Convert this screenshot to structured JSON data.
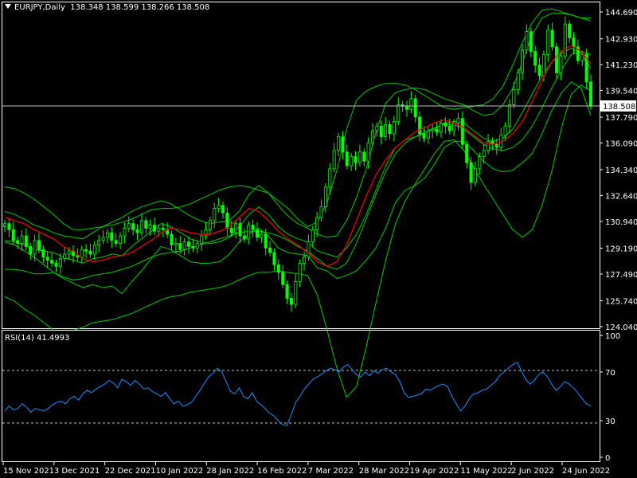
{
  "header": {
    "symbol": "EURJPY,Daily",
    "ohlc": "138.348 138.599 138.266 138.508"
  },
  "rsi_header": {
    "label": "RSI(14)",
    "value": "41.4993"
  },
  "colors": {
    "background": "#000000",
    "frame": "#ffffff",
    "candle": "#00ff00",
    "ma": "#ff0000",
    "bands": "#00cc00",
    "rsi": "#1e90ff",
    "level": "#c0c0c0"
  },
  "chart_data": [
    {
      "type": "candlestick",
      "title": "EURJPY,Daily",
      "x_ticks": [
        "15 Nov 2021",
        "3 Dec 2021",
        "22 Dec 2021",
        "10 Jan 2022",
        "28 Jan 2022",
        "16 Feb 2022",
        "7 Mar 2022",
        "28 Mar 2022",
        "19 Apr 2022",
        "11 May 2022",
        "2 Jun 2022",
        "24 Jun 2022"
      ],
      "y_ticks": [
        "144.690",
        "142.930",
        "141.230",
        "139.540",
        "137.790",
        "136.090",
        "134.340",
        "132.640",
        "130.940",
        "129.190",
        "127.490",
        "125.740",
        "124.040"
      ],
      "ylim": [
        124.04,
        144.69
      ],
      "current_price": "138.508",
      "close": [
        130.8,
        130.4,
        129.7,
        129.5,
        130.0,
        129.3,
        128.8,
        129.7,
        129.1,
        128.6,
        128.4,
        128.2,
        128.0,
        128.5,
        128.8,
        129.0,
        128.7,
        128.6,
        129.1,
        129.0,
        128.8,
        129.4,
        129.7,
        129.9,
        130.2,
        129.7,
        129.5,
        130.0,
        130.5,
        130.8,
        130.4,
        130.2,
        131.0,
        130.5,
        130.7,
        130.3,
        130.5,
        130.4,
        130.1,
        129.4,
        129.5,
        129.1,
        129.6,
        129.3,
        129.2,
        129.5,
        130.0,
        130.4,
        131.0,
        131.8,
        132.0,
        131.5,
        130.5,
        130.2,
        130.8,
        130.0,
        129.8,
        130.7,
        130.4,
        129.9,
        130.1,
        129.2,
        128.9,
        128.1,
        127.6,
        126.8,
        125.9,
        125.5,
        127.0,
        128.2,
        128.6,
        129.6,
        130.4,
        131.2,
        131.9,
        133.2,
        134.4,
        135.6,
        136.5,
        135.5,
        134.6,
        135.2,
        134.8,
        135.5,
        134.9,
        136.1,
        136.9,
        137.2,
        136.5,
        137.3,
        136.7,
        137.5,
        138.6,
        138.5,
        138.3,
        139.0,
        137.8,
        136.7,
        136.4,
        136.9,
        137.0,
        136.8,
        137.4,
        137.2,
        136.9,
        137.4,
        137.7,
        136.0,
        134.8,
        133.5,
        134.4,
        135.2,
        135.6,
        136.2,
        136.0,
        135.8,
        136.6,
        137.2,
        138.6,
        139.6,
        140.7,
        142.2,
        143.4,
        142.1,
        141.2,
        140.5,
        141.9,
        143.5,
        142.4,
        140.7,
        141.8,
        143.9,
        143.0,
        142.4,
        141.5,
        141.9,
        140.1,
        138.5
      ],
      "series": [
        {
          "name": "",
          "values": [
            129.7,
            129.6,
            129.4,
            129.1,
            129.0,
            128.9,
            128.6,
            128.4,
            128.2,
            128.5,
            128.6,
            128.8,
            128.7,
            129.3,
            129.8,
            130.3,
            130.8,
            130.6,
            130.2,
            129.8,
            129.6,
            129.5,
            129.6,
            129.9,
            130.6,
            131.4,
            131.9,
            131.4,
            130.6,
            130.1,
            129.8,
            129.6,
            129.0,
            128.8,
            128.6,
            129.2,
            130.1,
            131.4,
            133.0,
            134.6,
            135.8,
            136.3,
            136.5,
            136.7,
            137.0,
            137.4,
            137.5,
            137.4,
            136.9,
            136.4,
            136.2,
            136.4,
            137.0,
            138.1,
            139.3,
            140.5,
            141.4,
            142.0,
            142.3,
            142.0,
            141.0
          ]
        },
        {
          "name": "",
          "values": [
            131.6,
            131.4,
            131.1,
            130.7,
            130.5,
            130.2,
            130.0,
            129.9,
            129.8,
            130.2,
            130.6,
            130.9,
            131.2,
            131.6,
            131.9,
            132.1,
            132.3,
            132.1,
            131.7,
            131.3,
            131.0,
            130.8,
            130.9,
            131.0,
            131.6,
            132.7,
            133.3,
            132.8,
            132.0,
            131.3,
            130.8,
            130.5,
            130.1,
            129.9,
            130.0,
            131.0,
            132.5,
            134.4,
            136.8,
            138.7,
            139.4,
            139.6,
            139.7,
            139.6,
            139.3,
            139.0,
            138.8,
            138.6,
            138.2,
            137.9,
            138.0,
            138.6,
            139.7,
            141.4,
            143.2,
            144.3,
            144.6,
            144.6,
            144.5,
            144.3,
            144.1
          ]
        },
        {
          "name": "",
          "values": [
            127.8,
            127.8,
            127.7,
            127.5,
            127.5,
            127.6,
            127.2,
            126.9,
            126.6,
            126.8,
            126.6,
            126.7,
            126.2,
            127.0,
            127.7,
            128.5,
            129.3,
            129.1,
            128.7,
            128.3,
            128.2,
            128.2,
            128.3,
            128.8,
            129.6,
            130.1,
            130.5,
            130.0,
            129.2,
            128.9,
            128.8,
            128.7,
            127.9,
            127.7,
            127.2,
            127.4,
            127.7,
            128.4,
            129.2,
            130.5,
            132.2,
            133.0,
            133.3,
            133.8,
            134.7,
            135.8,
            136.2,
            136.2,
            135.6,
            134.9,
            134.4,
            134.2,
            134.3,
            134.8,
            135.4,
            136.7,
            138.2,
            139.4,
            140.1,
            139.7,
            137.9
          ]
        },
        {
          "name": "",
          "values": [
            131.2,
            131.0,
            130.8,
            130.4,
            130.1,
            129.8,
            129.3,
            129.0,
            128.5,
            128.3,
            128.4,
            128.6,
            128.7,
            128.9,
            129.3,
            129.7,
            130.2,
            130.5,
            130.4,
            130.2,
            130.1,
            130.1,
            130.3,
            130.6,
            131.2,
            131.8,
            131.6,
            131.0,
            130.3,
            129.8,
            129.4,
            128.9,
            128.3,
            128.0,
            128.3,
            129.4,
            131.0,
            132.6,
            134.0,
            135.0,
            135.8,
            136.3,
            136.8,
            137.1,
            137.4,
            137.6,
            137.4,
            137.1,
            136.6,
            136.1,
            136.0,
            136.2,
            136.7,
            137.5,
            138.8,
            140.2,
            141.4,
            142.1,
            142.5,
            142.1,
            141.3
          ]
        },
        {
          "name": "",
          "values": [
            129.6,
            129.4,
            129.0,
            128.6,
            128.1,
            127.6,
            127.3,
            127.1,
            127.2,
            127.4,
            127.5,
            127.6,
            127.8,
            128.0,
            128.3,
            128.6,
            128.8,
            128.9,
            129.0,
            129.2,
            129.4,
            129.6,
            129.8,
            130.0,
            130.2,
            130.3,
            130.3,
            130.2,
            130.0,
            129.7,
            129.3,
            129.0,
            128.5,
            128.0,
            127.8,
            128.2,
            129.5,
            131.1,
            132.7,
            134.2,
            135.4,
            136.1,
            136.5,
            136.8,
            137.1,
            137.3,
            137.3,
            137.0,
            136.5,
            136.0,
            135.7,
            135.6,
            135.8,
            136.3,
            137.2,
            138.4,
            139.7,
            140.9,
            141.9,
            142.1,
            141.9
          ]
        },
        {
          "name": "",
          "values": [
            133.2,
            133.1,
            132.8,
            132.4,
            131.9,
            131.4,
            130.8,
            130.4,
            130.4,
            130.5,
            130.6,
            130.7,
            130.9,
            131.1,
            131.4,
            131.7,
            131.8,
            131.8,
            131.9,
            132.1,
            132.4,
            132.7,
            133.0,
            133.2,
            133.3,
            133.2,
            133.0,
            132.8,
            132.3,
            131.8,
            131.1,
            130.6,
            130.9,
            132.2,
            134.3,
            137.0,
            138.9,
            139.5,
            139.8,
            140.0,
            140.0,
            139.9,
            139.6,
            139.2,
            138.8,
            138.4,
            138.3,
            138.4,
            138.5,
            138.6,
            139.0,
            139.8,
            141.2,
            142.7,
            144.0,
            144.8,
            144.9,
            144.7,
            144.5,
            144.3,
            144.3
          ]
        },
        {
          "name": "",
          "values": [
            126.0,
            125.7,
            125.2,
            124.8,
            124.3,
            123.8,
            123.8,
            123.8,
            124.0,
            124.3,
            124.4,
            124.5,
            124.7,
            124.9,
            125.2,
            125.5,
            125.8,
            126.0,
            126.1,
            126.3,
            126.4,
            126.5,
            126.6,
            126.8,
            127.1,
            127.4,
            127.6,
            127.6,
            127.7,
            127.6,
            127.5,
            127.4,
            126.1,
            123.8,
            121.3,
            119.4,
            120.1,
            122.7,
            125.6,
            128.4,
            130.8,
            132.3,
            133.4,
            134.4,
            135.4,
            136.2,
            136.3,
            135.6,
            134.5,
            133.4,
            132.4,
            131.4,
            130.4,
            129.9,
            130.4,
            132.0,
            134.2,
            137.1,
            139.3,
            139.9,
            139.5
          ]
        }
      ]
    },
    {
      "type": "line",
      "title": "RSI(14) 41.4993",
      "ylim": [
        0,
        100
      ],
      "y_ticks": [
        "100",
        "70",
        "30",
        "0"
      ],
      "levels": [
        70,
        30
      ],
      "series": [
        {
          "name": "",
          "values": [
            38,
            42,
            39,
            40,
            44,
            41,
            37,
            40,
            39,
            38,
            40,
            43,
            45,
            46,
            44,
            48,
            50,
            47,
            52,
            55,
            53,
            56,
            58,
            60,
            63,
            61,
            57,
            64,
            62,
            59,
            63,
            60,
            56,
            57,
            54,
            52,
            50,
            53,
            48,
            44,
            46,
            42,
            43,
            45,
            50,
            55,
            61,
            66,
            69,
            73,
            70,
            62,
            54,
            52,
            57,
            50,
            48,
            53,
            46,
            43,
            40,
            36,
            34,
            30,
            27,
            26,
            35,
            45,
            50,
            56,
            60,
            64,
            66,
            68,
            71,
            73,
            72,
            70,
            74,
            76,
            72,
            68,
            66,
            70,
            67,
            71,
            69,
            72,
            73,
            70,
            68,
            62,
            53,
            49,
            50,
            51,
            52,
            56,
            55,
            57,
            59,
            60,
            58,
            50,
            44,
            38,
            42,
            48,
            52,
            53,
            55,
            56,
            59,
            62,
            67,
            70,
            73,
            76,
            78,
            71,
            64,
            60,
            63,
            68,
            70,
            66,
            60,
            55,
            58,
            62,
            60,
            57,
            53,
            48,
            44,
            42
          ]
        }
      ]
    }
  ]
}
